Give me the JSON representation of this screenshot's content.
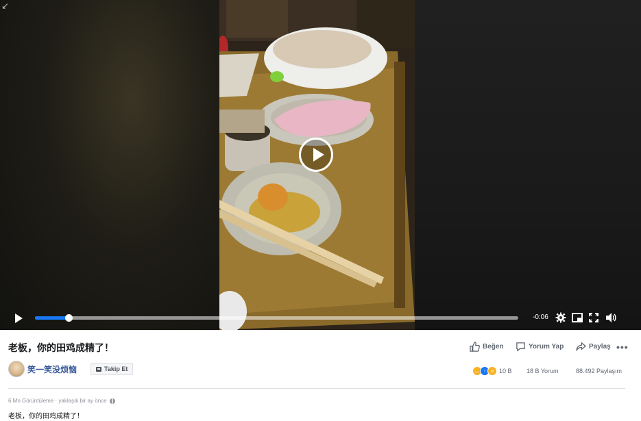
{
  "video": {
    "time_remaining": "-0:06",
    "progress_fraction": 0.07
  },
  "post": {
    "title": "老板，你的田鸡成精了！",
    "page_name": "笑一笑没烦恼",
    "follow_label": "Takip Et",
    "actions": {
      "like": "Beğen",
      "comment": "Yorum Yap",
      "share": "Paylaş"
    },
    "reaction_count": "10 B",
    "comment_count": "18 B Yorum",
    "share_count": "88.492 Paylaşım",
    "views": "6 Mn Görüntüleme",
    "separator": " · ",
    "posted": "yaklaşık bir ay önce",
    "description": "老板，你的田鸡成精了！"
  },
  "colors": {
    "accent": "#1877f2",
    "page_link": "#385898",
    "muted_text": "#606770"
  }
}
